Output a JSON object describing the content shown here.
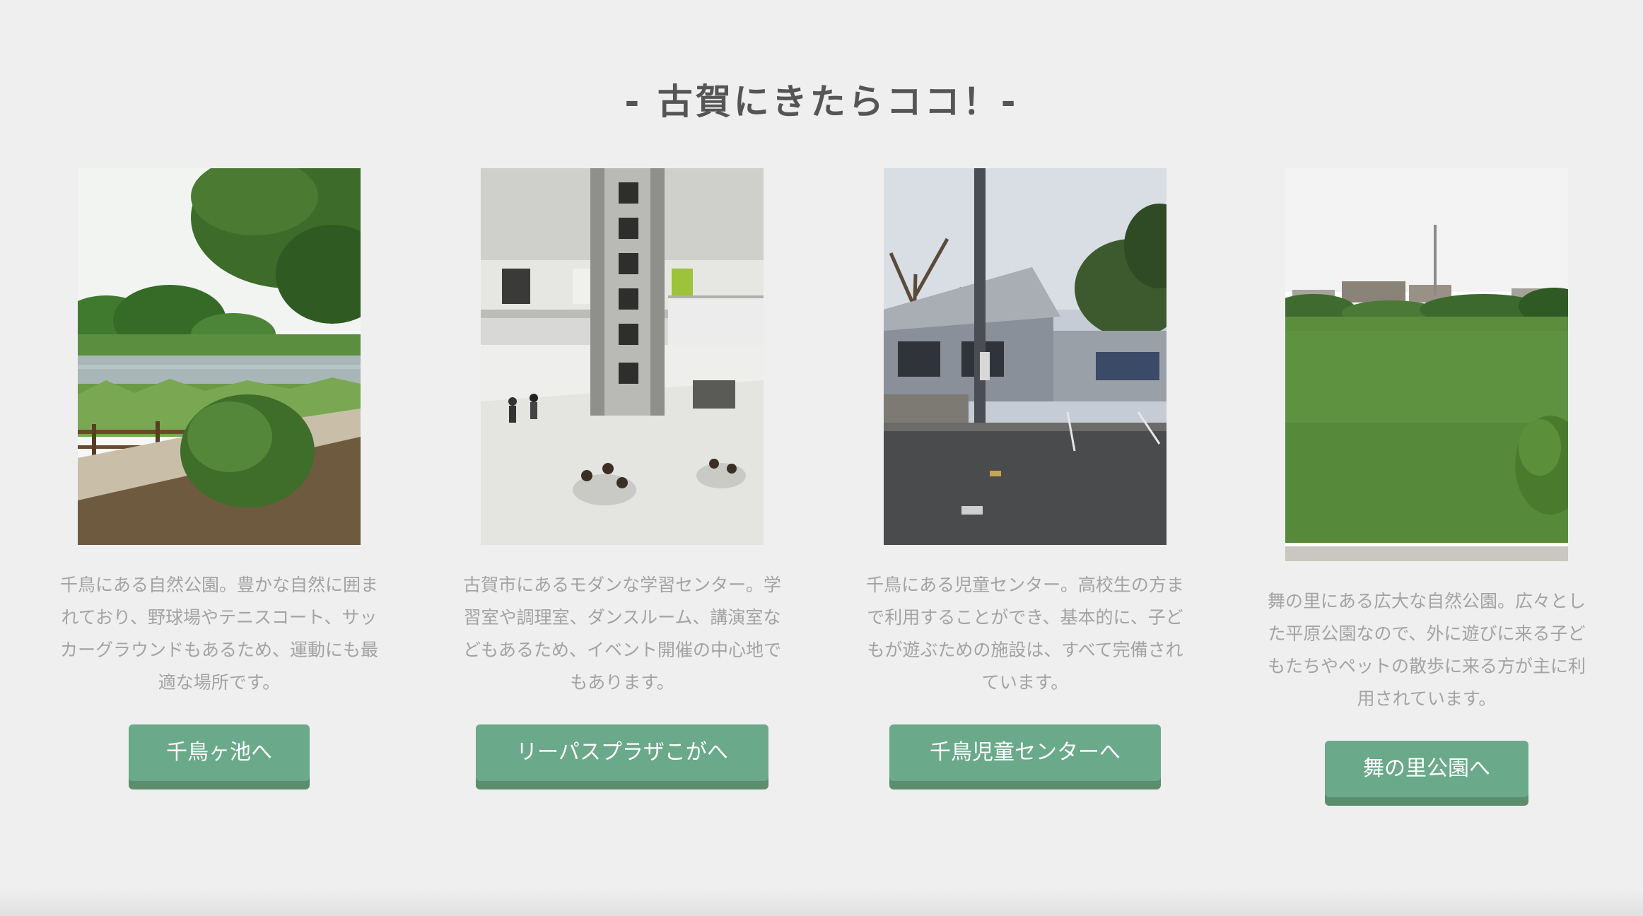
{
  "section": {
    "title": "- 古賀にきたらココ！-"
  },
  "cards": [
    {
      "description": "千鳥にある自然公園。豊かな自然に囲まれており、野球場やテニスコート、サッカーグラウンドもあるため、運動にも最適な場所です。",
      "button_label": "千鳥ヶ池へ"
    },
    {
      "description": "古賀市にあるモダンな学習センター。学習室や調理室、ダンスルーム、講演室などもあるため、イベント開催の中心地でもあります。",
      "button_label": "リーパスプラザこがへ"
    },
    {
      "description": "千鳥にある児童センター。高校生の方まで利用することができ、基本的に、子どもが遊ぶための施設は、すべて完備されています。",
      "button_label": "千鳥児童センターへ"
    },
    {
      "description": "舞の里にある広大な自然公園。広々とした平原公園なので、外に遊びに来る子どもたちやペットの散歩に来る方が主に利用されています。",
      "button_label": "舞の里公園へ"
    }
  ],
  "colors": {
    "background": "#efefef",
    "title_text": "#555555",
    "description_text": "#a3a3a3",
    "button": "#6aa989",
    "button_shadow": "#5a8e6d",
    "button_text": "#ffffff"
  }
}
